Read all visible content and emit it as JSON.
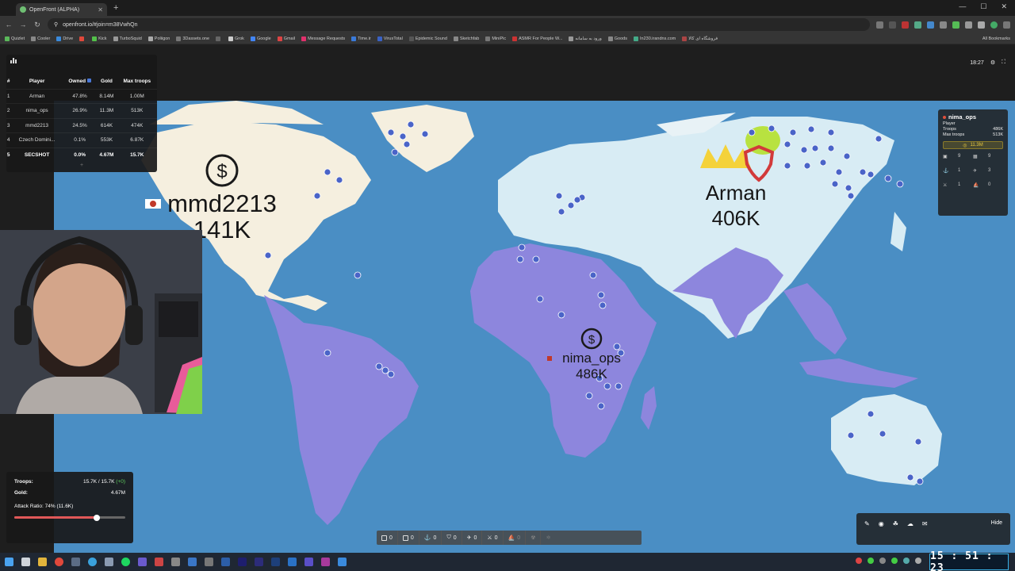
{
  "browser": {
    "tab_title": "OpenFront (ALPHA)",
    "url": "openfront.io/#join=m38VwhQn",
    "bookmarks": [
      "Quizlet",
      "Cooler",
      "Drive",
      "",
      "Kick",
      "TurboSquid",
      "Poliigon",
      "3Dassets.one",
      "",
      "Grok",
      "Google",
      "Gmail",
      "Message Requests",
      "Time.ir",
      "VirusTotal",
      "Epidemic Sound",
      "Sketchfab",
      "MiniPic",
      "ASMR For People W...",
      "ورود به سامانه",
      "Goods",
      "In230.irandns.com",
      "فروشگاه ای کالا"
    ],
    "all_bookmarks": "All Bookmarks",
    "accent": "#8ab4f8"
  },
  "leaderboard": {
    "headers": [
      "#",
      "Player",
      "Owned",
      "Gold",
      "Max troops"
    ],
    "rows": [
      {
        "rank": "1",
        "player": "Arman",
        "owned": "47.8%",
        "gold": "8.14M",
        "troops": "1.00M"
      },
      {
        "rank": "2",
        "player": "nima_ops",
        "owned": "26.9%",
        "gold": "11.3M",
        "troops": "513K"
      },
      {
        "rank": "3",
        "player": "mmd2213",
        "owned": "24.5%",
        "gold": "614K",
        "troops": "474K"
      },
      {
        "rank": "4",
        "player": "Czech Domini...",
        "owned": "0.1%",
        "gold": "553K",
        "troops": "6.87K"
      },
      {
        "rank": "5",
        "player": "SECSHOT",
        "owned": "0.0%",
        "gold": "4.67M",
        "troops": "15.7K"
      }
    ],
    "more": "+"
  },
  "game_time": "18:27",
  "map_labels": {
    "mmd": {
      "name": "mmd2213",
      "troops": "141K"
    },
    "arman": {
      "name": "Arman",
      "troops": "406K"
    },
    "nima": {
      "name": "nima_ops",
      "troops": "486K"
    }
  },
  "player_panel": {
    "name": "nima_ops",
    "type_label": "Player",
    "troops_label": "Troops",
    "troops_value": "486K",
    "max_label": "Max troops",
    "max_value": "513K",
    "gold": "11.3M",
    "counts": [
      "9",
      "9",
      "1",
      "3",
      "1",
      "0"
    ]
  },
  "stats": {
    "troops_label": "Troops:",
    "troops_value": "15.7K / 15.7K",
    "troops_delta": "(+0)",
    "gold_label": "Gold:",
    "gold_value": "4.67M",
    "ratio_label": "Attack Ratio: 74% (11.6K)",
    "ratio": 0.74
  },
  "buildbar": [
    "0",
    "0",
    "0",
    "0",
    "0",
    "0",
    "0",
    "",
    ""
  ],
  "options": {
    "hide_label": "Hide"
  },
  "taskbar": {
    "clock": "15 : 51 : 23"
  },
  "colors": {
    "ocean": "#4a8ec4",
    "arman": "#d8ecf4",
    "mmd": "#f5efdf",
    "nima": "#8d86dd",
    "gold": "#e8c840"
  }
}
